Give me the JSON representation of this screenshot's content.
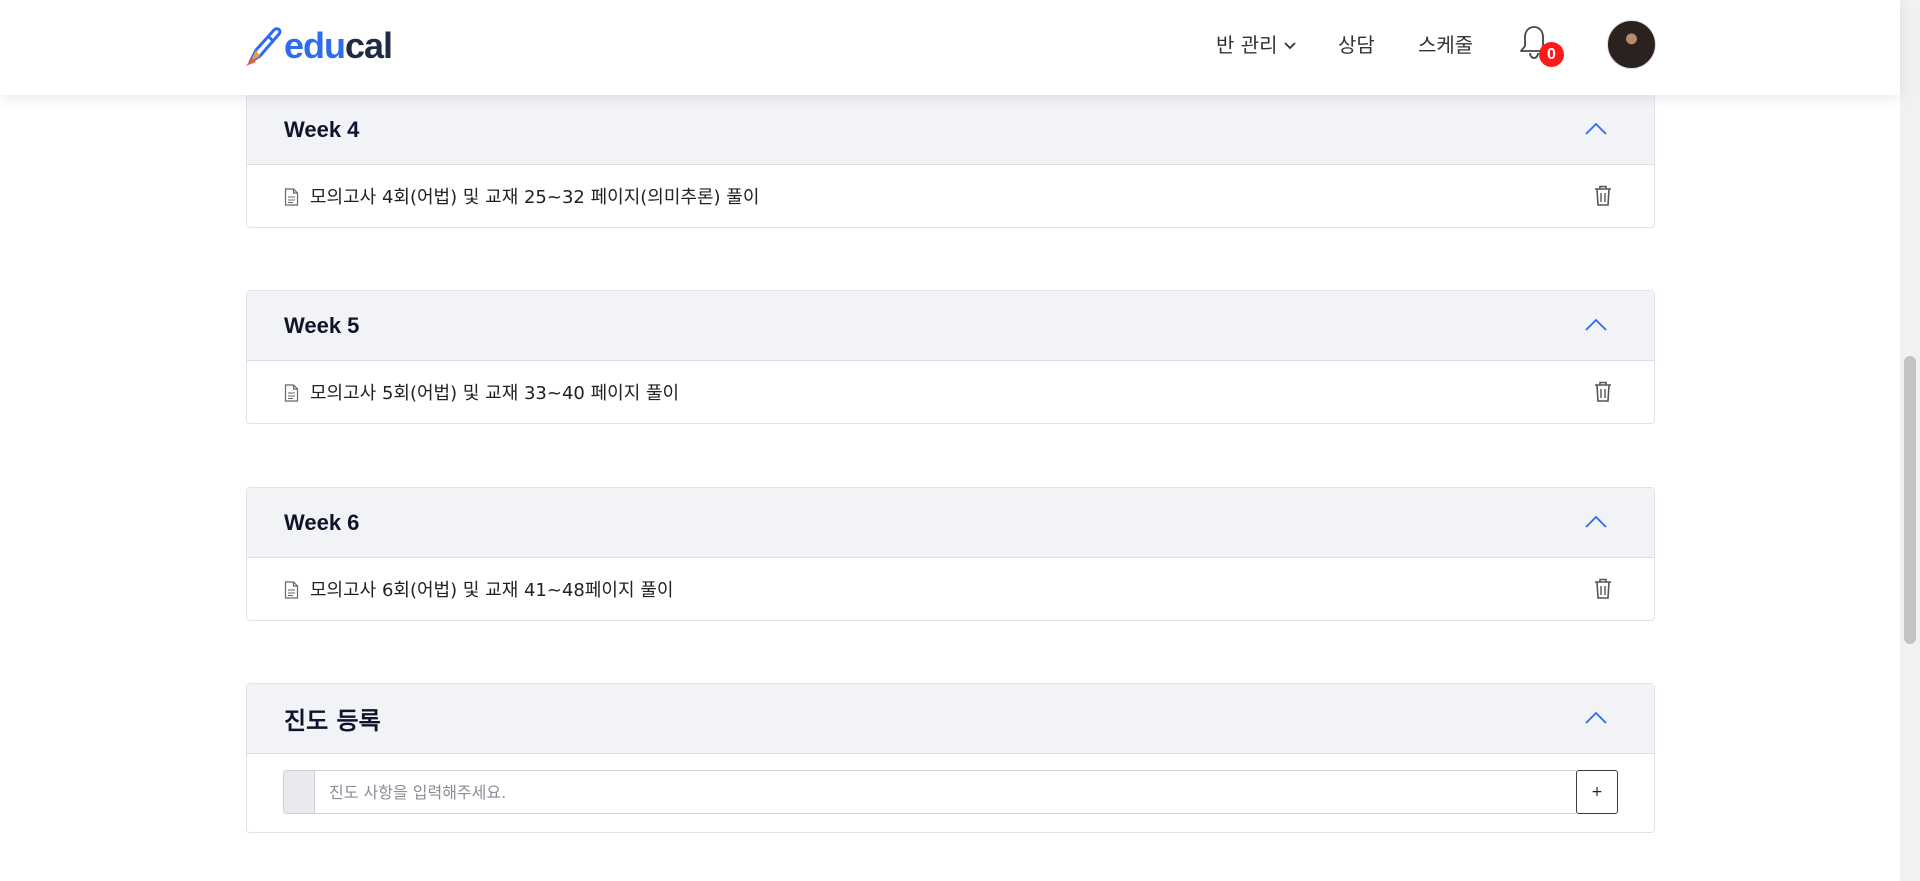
{
  "header": {
    "logo_edu": "edu",
    "logo_cal": "cal",
    "nav": {
      "class_manage": "반 관리",
      "counsel": "상담",
      "schedule": "스케줄"
    },
    "notification_count": "0"
  },
  "weeks": [
    {
      "title": "Week 4",
      "item": "모의고사 4회(어법) 및 교재 25~32 페이지(의미추론) 풀이"
    },
    {
      "title": "Week 5",
      "item": "모의고사 5회(어법) 및 교재 33~40 페이지 풀이"
    },
    {
      "title": "Week 6",
      "item": "모의고사 6회(어법) 및 교재 41~48페이지 풀이"
    }
  ],
  "register": {
    "title": "진도 등록",
    "placeholder": "진도 사항을 입력해주세요.",
    "add_label": "+"
  },
  "colors": {
    "brand_blue": "#2f6bf0",
    "brand_dark": "#1f2a44",
    "badge_red": "#ff1a1a",
    "card_header_bg": "#f2f3f7"
  }
}
